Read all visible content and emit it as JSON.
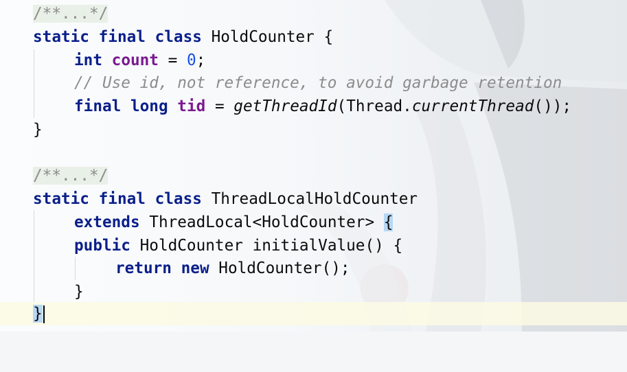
{
  "editor": {
    "line1": {
      "fold": "/**...*/"
    },
    "line2": {
      "kw_static": "static",
      "kw_final": "final",
      "kw_class": "class",
      "class_name": "HoldCounter",
      "brace": "{"
    },
    "line3": {
      "kw_int": "int",
      "field": "count",
      "op": "=",
      "value": "0",
      "semi": ";"
    },
    "line4": {
      "comment": "// Use id, not reference, to avoid garbage retention"
    },
    "line5": {
      "kw_final": "final",
      "kw_long": "long",
      "field": "tid",
      "op": "=",
      "method": "getThreadId",
      "open": "(",
      "type": "Thread",
      "dot": ".",
      "call": "currentThread",
      "close": "());"
    },
    "line6": {
      "brace": "}"
    },
    "line8": {
      "fold": "/**...*/"
    },
    "line9": {
      "kw_static": "static",
      "kw_final": "final",
      "kw_class": "class",
      "class_name": "ThreadLocalHoldCounter"
    },
    "line10": {
      "kw_extends": "extends",
      "type": "ThreadLocal<HoldCounter>",
      "brace": "{"
    },
    "line11": {
      "kw_public": "public",
      "return_type": "HoldCounter",
      "method": "initialValue() {"
    },
    "line12": {
      "kw_return": "return",
      "kw_new": "new",
      "call": "HoldCounter();"
    },
    "line13": {
      "brace": "}"
    },
    "line14": {
      "brace": "}"
    }
  }
}
